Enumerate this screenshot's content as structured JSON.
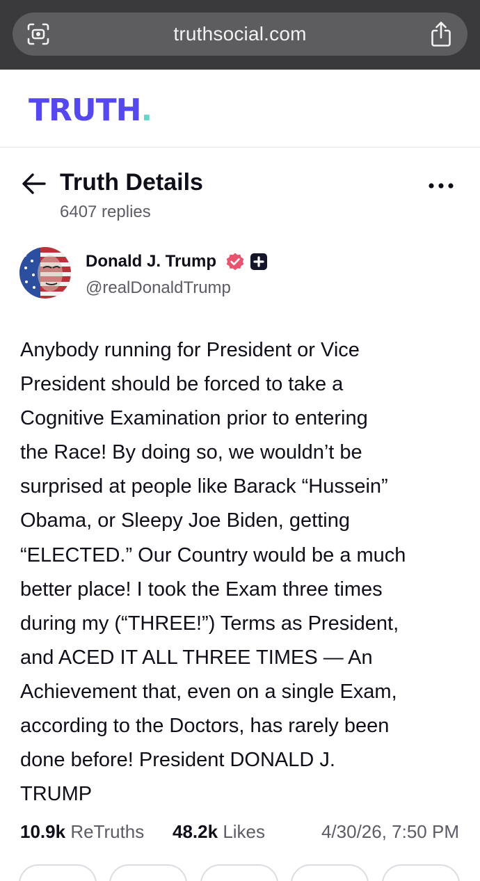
{
  "browser": {
    "url": "truthsocial.com"
  },
  "header": {
    "logo_text": "TRUTH",
    "logo_dot": "."
  },
  "details": {
    "title": "Truth Details",
    "replies": "6407 replies"
  },
  "author": {
    "name": "Donald J. Trump",
    "handle": "@realDonaldTrump"
  },
  "post": {
    "lines": [
      "Anybody running for President or Vice",
      "President should be forced to take a",
      "Cognitive Examination prior to entering",
      "the Race! By doing so, we wouldn’t be",
      "surprised at people like Barack “Hussein”",
      "Obama, or Sleepy Joe Biden, getting",
      "“ELECTED.” Our Country would be a much",
      "better place! I took the Exam three times",
      "during my (“THREE!”) Terms as President,",
      "and ACED IT ALL THREE TIMES — An",
      "Achievement that, even on a single Exam,",
      "according to the Doctors, has rarely been",
      "done before! President DONALD J.",
      "TRUMP"
    ]
  },
  "stats": {
    "retruths_count": "10.9k",
    "retruths_label": "ReTruths",
    "likes_count": "48.2k",
    "likes_label": "Likes",
    "timestamp": "4/30/26, 7:50 PM"
  },
  "icons": {
    "reader": "reader-mode-icon",
    "share": "share-icon",
    "back": "arrow-left-icon",
    "more": "more-dots-icon",
    "verified": "verified-badge-icon",
    "plus": "plus-badge-icon"
  },
  "colors": {
    "brand_purple": "#5448ee",
    "brand_teal": "#65d6c8",
    "verified_pink": "#e8546f",
    "text_primary": "#0f0f1a",
    "text_secondary": "#5c5c66"
  }
}
